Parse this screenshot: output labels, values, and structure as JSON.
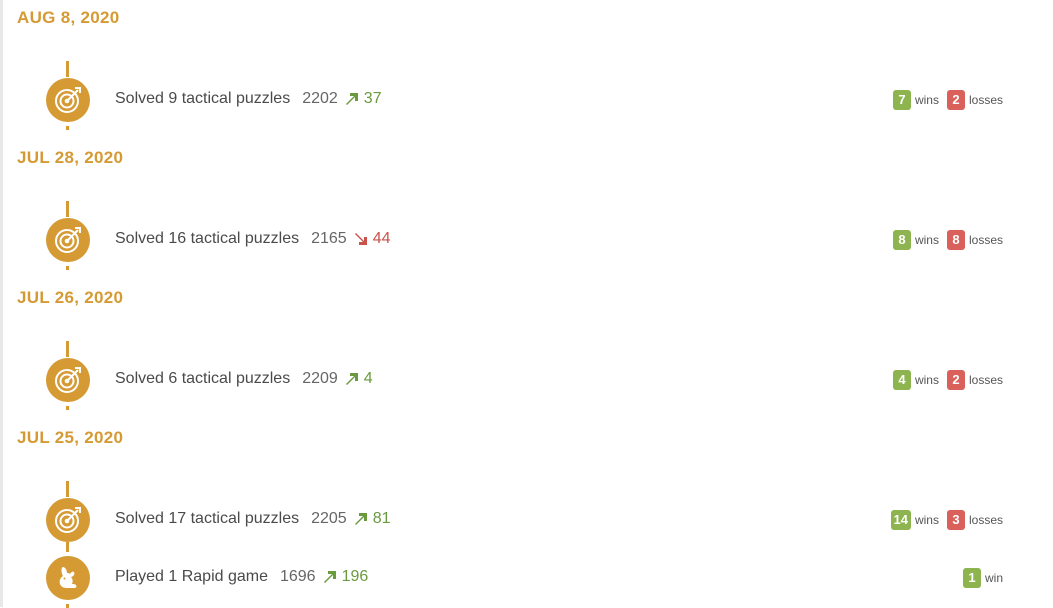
{
  "colors": {
    "accent": "#d59a33",
    "win": "#8db44e",
    "loss": "#d9605b",
    "up": "#6a9a3e",
    "down": "#c9524b"
  },
  "days": [
    {
      "date": "AUG 8, 2020",
      "entries": [
        {
          "icon": "target-icon",
          "text": "Solved 9 tactical puzzles",
          "rating": "2202",
          "trend": "up",
          "delta": "37",
          "wins": "7",
          "wins_label": "wins",
          "losses": "2",
          "losses_label": "losses"
        }
      ]
    },
    {
      "date": "JUL 28, 2020",
      "entries": [
        {
          "icon": "target-icon",
          "text": "Solved 16 tactical puzzles",
          "rating": "2165",
          "trend": "down",
          "delta": "44",
          "wins": "8",
          "wins_label": "wins",
          "losses": "8",
          "losses_label": "losses"
        }
      ]
    },
    {
      "date": "JUL 26, 2020",
      "entries": [
        {
          "icon": "target-icon",
          "text": "Solved 6 tactical puzzles",
          "rating": "2209",
          "trend": "up",
          "delta": "4",
          "wins": "4",
          "wins_label": "wins",
          "losses": "2",
          "losses_label": "losses"
        }
      ]
    },
    {
      "date": "JUL 25, 2020",
      "entries": [
        {
          "icon": "target-icon",
          "text": "Solved 17 tactical puzzles",
          "rating": "2205",
          "trend": "up",
          "delta": "81",
          "wins": "14",
          "wins_label": "wins",
          "losses": "3",
          "losses_label": "losses"
        },
        {
          "icon": "rabbit-icon",
          "text": "Played 1 Rapid game",
          "rating": "1696",
          "trend": "up",
          "delta": "196",
          "wins": "1",
          "wins_label": "win"
        }
      ]
    }
  ]
}
